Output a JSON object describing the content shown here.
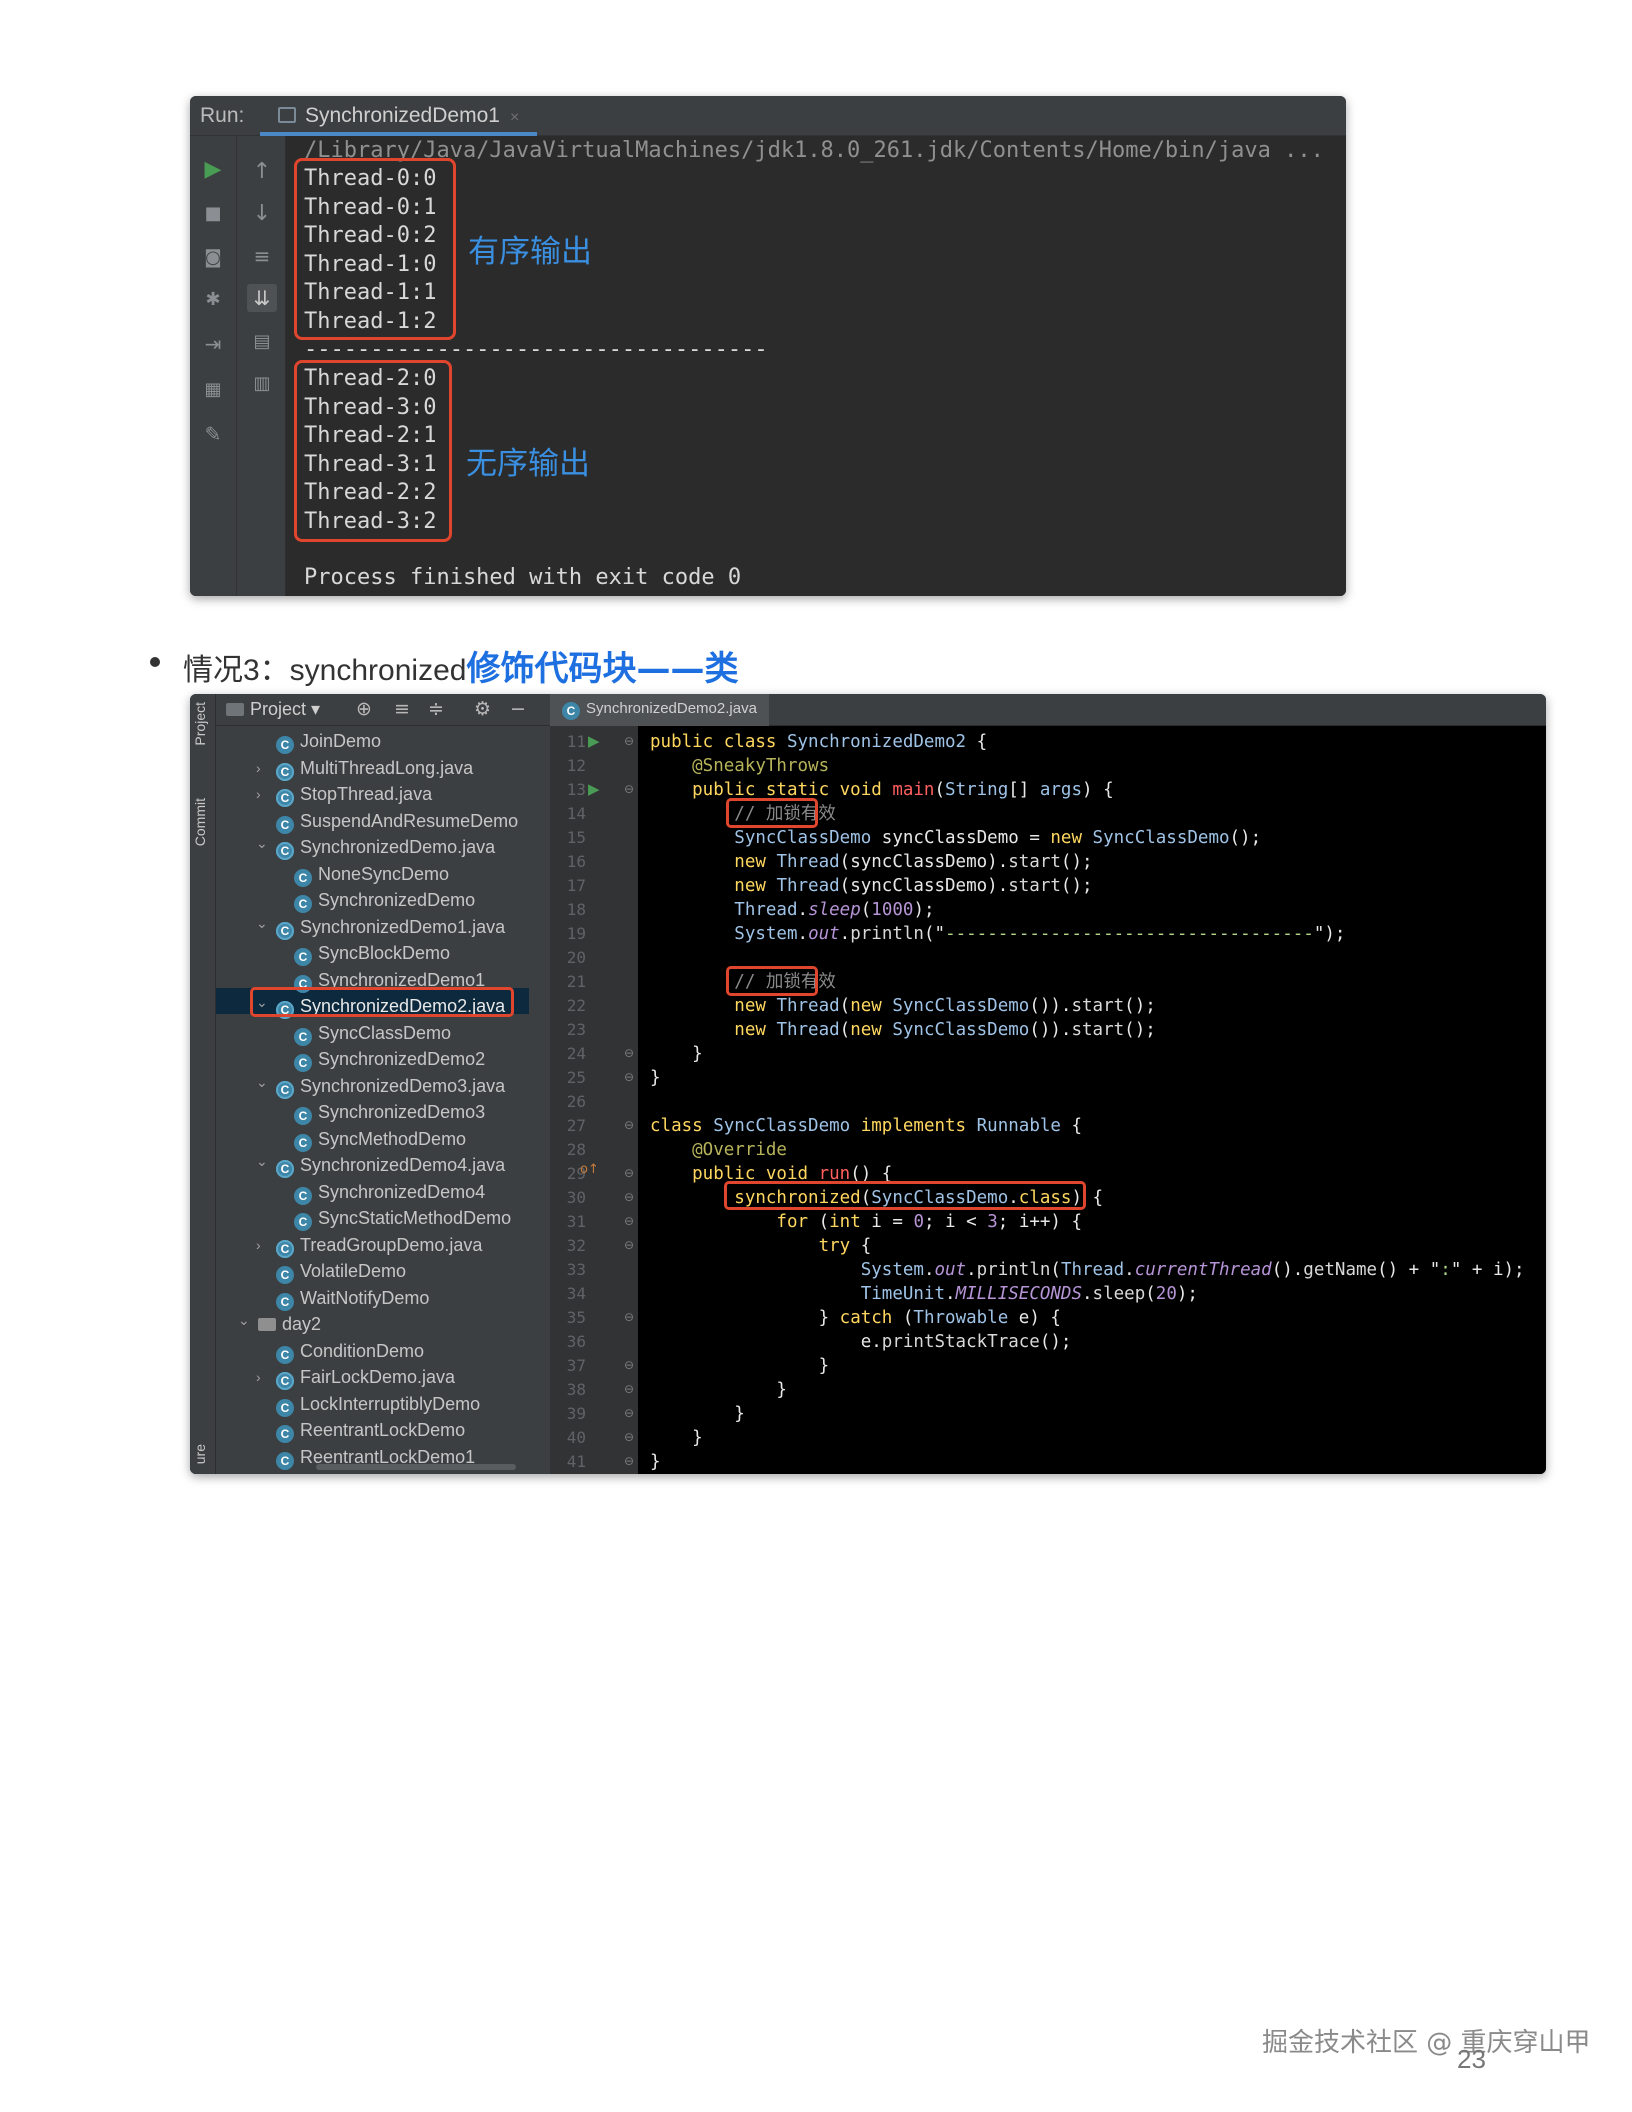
{
  "run_panel": {
    "run_label": "Run:",
    "tab_title": "SynchronizedDemo1",
    "tab_close": "×",
    "java_command": "/Library/Java/JavaVirtualMachines/jdk1.8.0_261.jdk/Contents/Home/bin/java ...",
    "ordered_lines": [
      "Thread-0:0",
      "Thread-0:1",
      "Thread-0:2",
      "Thread-1:0",
      "Thread-1:1",
      "Thread-1:2"
    ],
    "separator": "-----------------------------------",
    "unordered_lines": [
      "Thread-2:0",
      "Thread-3:0",
      "Thread-2:1",
      "Thread-3:1",
      "Thread-2:2",
      "Thread-3:2"
    ],
    "finish_message": "Process finished with exit code 0",
    "ordered_note": "有序输出",
    "unordered_note": "无序输出",
    "tool_icons": [
      "run-icon",
      "up-arrow-icon",
      "stop-icon",
      "down-arrow-icon",
      "camera-icon",
      "soft-wrap-icon",
      "debug-icon",
      "scroll-to-end-icon",
      "import-icon",
      "print-icon",
      "layout-icon",
      "trash-icon",
      "pin-icon"
    ]
  },
  "bullet": {
    "prefix": "情况3：synchronized",
    "highlight1": "修饰代码块",
    "dash": "——",
    "highlight2": "类"
  },
  "ide": {
    "side_labels": [
      "Project",
      "Commit",
      "ure"
    ],
    "project_title": "Project",
    "editor_tab": "SynchronizedDemo2.java",
    "tree": [
      {
        "label": "JoinDemo",
        "indent": 1,
        "arrow": "",
        "icon": "class"
      },
      {
        "label": "MultiThreadLong.java",
        "indent": 1,
        "arrow": ">",
        "icon": "file"
      },
      {
        "label": "StopThread.java",
        "indent": 1,
        "arrow": ">",
        "icon": "file"
      },
      {
        "label": "SuspendAndResumeDemo",
        "indent": 1,
        "arrow": "",
        "icon": "class"
      },
      {
        "label": "SynchronizedDemo.java",
        "indent": 1,
        "arrow": "v",
        "icon": "file"
      },
      {
        "label": "NoneSyncDemo",
        "indent": 2,
        "arrow": "",
        "icon": "class"
      },
      {
        "label": "SynchronizedDemo",
        "indent": 2,
        "arrow": "",
        "icon": "class"
      },
      {
        "label": "SynchronizedDemo1.java",
        "indent": 1,
        "arrow": "v",
        "icon": "file"
      },
      {
        "label": "SyncBlockDemo",
        "indent": 2,
        "arrow": "",
        "icon": "class"
      },
      {
        "label": "SynchronizedDemo1",
        "indent": 2,
        "arrow": "",
        "icon": "class"
      },
      {
        "label": "SynchronizedDemo2.java",
        "indent": 1,
        "arrow": "v",
        "icon": "file",
        "selected": true
      },
      {
        "label": "SyncClassDemo",
        "indent": 2,
        "arrow": "",
        "icon": "class"
      },
      {
        "label": "SynchronizedDemo2",
        "indent": 2,
        "arrow": "",
        "icon": "class"
      },
      {
        "label": "SynchronizedDemo3.java",
        "indent": 1,
        "arrow": "v",
        "icon": "file"
      },
      {
        "label": "SynchronizedDemo3",
        "indent": 2,
        "arrow": "",
        "icon": "class"
      },
      {
        "label": "SyncMethodDemo",
        "indent": 2,
        "arrow": "",
        "icon": "class"
      },
      {
        "label": "SynchronizedDemo4.java",
        "indent": 1,
        "arrow": "v",
        "icon": "file"
      },
      {
        "label": "SynchronizedDemo4",
        "indent": 2,
        "arrow": "",
        "icon": "class"
      },
      {
        "label": "SyncStaticMethodDemo",
        "indent": 2,
        "arrow": "",
        "icon": "class"
      },
      {
        "label": "TreadGroupDemo.java",
        "indent": 1,
        "arrow": ">",
        "icon": "file"
      },
      {
        "label": "VolatileDemo",
        "indent": 1,
        "arrow": "",
        "icon": "class"
      },
      {
        "label": "WaitNotifyDemo",
        "indent": 1,
        "arrow": "",
        "icon": "class"
      },
      {
        "label": "day2",
        "indent": 0,
        "arrow": "v",
        "icon": "folder"
      },
      {
        "label": "ConditionDemo",
        "indent": 1,
        "arrow": "",
        "icon": "class"
      },
      {
        "label": "FairLockDemo.java",
        "indent": 1,
        "arrow": ">",
        "icon": "file"
      },
      {
        "label": "LockInterruptiblyDemo",
        "indent": 1,
        "arrow": "",
        "icon": "class"
      },
      {
        "label": "ReentrantLockDemo",
        "indent": 1,
        "arrow": "",
        "icon": "class"
      },
      {
        "label": "ReentrantLockDemo1",
        "indent": 1,
        "arrow": "",
        "icon": "class"
      }
    ],
    "line_numbers": [
      "11",
      "12",
      "13",
      "14",
      "15",
      "16",
      "17",
      "18",
      "19",
      "20",
      "21",
      "22",
      "23",
      "24",
      "25",
      "26",
      "27",
      "28",
      "29",
      "30",
      "31",
      "32",
      "33",
      "34",
      "35",
      "36",
      "37",
      "38",
      "39",
      "40",
      "41"
    ],
    "comment_text": "// 加锁有效",
    "code": [
      [
        [
          "kw",
          "public class "
        ],
        [
          "cls",
          "SynchronizedDemo2 "
        ],
        [
          "wh",
          "{"
        ]
      ],
      [
        [
          "ann",
          "    @SneakyThrows"
        ]
      ],
      [
        [
          "kw",
          "    public static void "
        ],
        [
          "mth",
          "main"
        ],
        [
          "wh",
          "("
        ],
        [
          "cls",
          "String"
        ],
        [
          "wh",
          "[] "
        ],
        [
          "cls",
          "args"
        ],
        [
          "wh",
          ") {"
        ]
      ],
      [
        [
          "cmt",
          "        // 加锁有效"
        ]
      ],
      [
        [
          "cls",
          "        SyncClassDemo "
        ],
        [
          "wh",
          "syncClassDemo "
        ],
        [
          "wh",
          "= "
        ],
        [
          "kw",
          "new "
        ],
        [
          "cls",
          "SyncClassDemo"
        ],
        [
          "wh",
          "();"
        ]
      ],
      [
        [
          "kw",
          "        new "
        ],
        [
          "cls",
          "Thread"
        ],
        [
          "wh",
          "(syncClassDemo)."
        ],
        [
          "fn",
          "start"
        ],
        [
          "wh",
          "();"
        ]
      ],
      [
        [
          "kw",
          "        new "
        ],
        [
          "cls",
          "Thread"
        ],
        [
          "wh",
          "(syncClassDemo)."
        ],
        [
          "fn",
          "start"
        ],
        [
          "wh",
          "();"
        ]
      ],
      [
        [
          "cls",
          "        Thread"
        ],
        [
          "wh",
          "."
        ],
        [
          "ital",
          "sleep"
        ],
        [
          "wh",
          "("
        ],
        [
          "num",
          "1000"
        ],
        [
          "wh",
          ");"
        ]
      ],
      [
        [
          "cls",
          "        System"
        ],
        [
          "wh",
          "."
        ],
        [
          "ital",
          "out"
        ],
        [
          "wh",
          "."
        ],
        [
          "fn",
          "println"
        ],
        [
          "wh",
          "(\""
        ],
        [
          "str",
          "-----------------------------------"
        ],
        [
          "wh",
          "\");"
        ]
      ],
      [
        [
          "wh",
          ""
        ]
      ],
      [
        [
          "cmt",
          "        // 加锁有效"
        ]
      ],
      [
        [
          "kw",
          "        new "
        ],
        [
          "cls",
          "Thread"
        ],
        [
          "wh",
          "("
        ],
        [
          "kw",
          "new "
        ],
        [
          "cls",
          "SyncClassDemo"
        ],
        [
          "wh",
          "())."
        ],
        [
          "fn",
          "start"
        ],
        [
          "wh",
          "();"
        ]
      ],
      [
        [
          "kw",
          "        new "
        ],
        [
          "cls",
          "Thread"
        ],
        [
          "wh",
          "("
        ],
        [
          "kw",
          "new "
        ],
        [
          "cls",
          "SyncClassDemo"
        ],
        [
          "wh",
          "())."
        ],
        [
          "fn",
          "start"
        ],
        [
          "wh",
          "();"
        ]
      ],
      [
        [
          "wh",
          "    }"
        ]
      ],
      [
        [
          "wh",
          "}"
        ]
      ],
      [
        [
          "wh",
          ""
        ]
      ],
      [
        [
          "kw",
          "class "
        ],
        [
          "cls",
          "SyncClassDemo "
        ],
        [
          "kw",
          "implements "
        ],
        [
          "cls",
          "Runnable "
        ],
        [
          "wh",
          "{"
        ]
      ],
      [
        [
          "ann",
          "    @Override"
        ]
      ],
      [
        [
          "kw",
          "    public void "
        ],
        [
          "mth",
          "run"
        ],
        [
          "wh",
          "() {"
        ]
      ],
      [
        [
          "kw",
          "        synchronized"
        ],
        [
          "wh",
          "("
        ],
        [
          "cls",
          "SyncClassDemo"
        ],
        [
          "wh",
          "."
        ],
        [
          "kw",
          "class"
        ],
        [
          "wh",
          ") {"
        ]
      ],
      [
        [
          "kw",
          "            for "
        ],
        [
          "wh",
          "("
        ],
        [
          "kw",
          "int "
        ],
        [
          "wh",
          "i = "
        ],
        [
          "num",
          "0"
        ],
        [
          "wh",
          "; i < "
        ],
        [
          "num",
          "3"
        ],
        [
          "wh",
          "; i++) {"
        ]
      ],
      [
        [
          "kw",
          "                try "
        ],
        [
          "wh",
          "{"
        ]
      ],
      [
        [
          "cls",
          "                    System"
        ],
        [
          "wh",
          "."
        ],
        [
          "ital",
          "out"
        ],
        [
          "wh",
          "."
        ],
        [
          "fn",
          "println"
        ],
        [
          "wh",
          "("
        ],
        [
          "cls",
          "Thread"
        ],
        [
          "wh",
          "."
        ],
        [
          "ital",
          "currentThread"
        ],
        [
          "wh",
          "()."
        ],
        [
          "fn",
          "getName"
        ],
        [
          "wh",
          "() + \""
        ],
        [
          "str",
          ":"
        ],
        [
          "wh",
          "\" + i);"
        ]
      ],
      [
        [
          "cls",
          "                    TimeUnit"
        ],
        [
          "wh",
          "."
        ],
        [
          "ital",
          "MILLISECONDS"
        ],
        [
          "wh",
          "."
        ],
        [
          "fn",
          "sleep"
        ],
        [
          "wh",
          "("
        ],
        [
          "num",
          "20"
        ],
        [
          "wh",
          ");"
        ]
      ],
      [
        [
          "wh",
          "                } "
        ],
        [
          "kw",
          "catch "
        ],
        [
          "wh",
          "("
        ],
        [
          "cls",
          "Throwable "
        ],
        [
          "wh",
          "e) {"
        ]
      ],
      [
        [
          "wh",
          "                    e."
        ],
        [
          "fn",
          "printStackTrace"
        ],
        [
          "wh",
          "();"
        ]
      ],
      [
        [
          "wh",
          "                }"
        ]
      ],
      [
        [
          "wh",
          "            }"
        ]
      ],
      [
        [
          "wh",
          "        }"
        ]
      ],
      [
        [
          "wh",
          "    }"
        ]
      ],
      [
        [
          "wh",
          "}"
        ]
      ]
    ]
  },
  "footer": {
    "watermark": "掘金技术社区 @ 重庆穿山甲",
    "page_number": "23"
  }
}
